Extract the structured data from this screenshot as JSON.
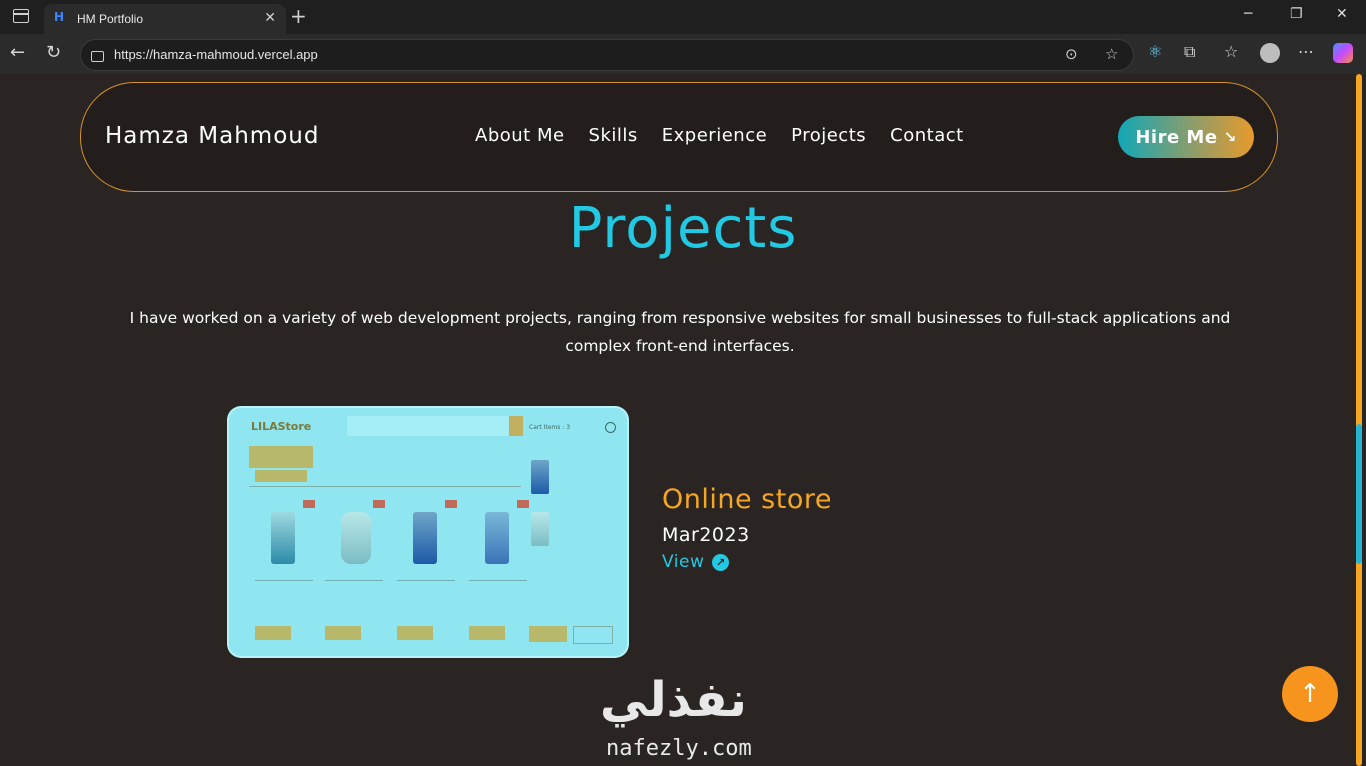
{
  "browser": {
    "tab_title": "HM Portfolio",
    "tab_favicon": "H",
    "url": "https://hamza-mahmoud.vercel.app"
  },
  "navbar": {
    "brand": "Hamza Mahmoud",
    "links": [
      "About Me",
      "Skills",
      "Experience",
      "Projects",
      "Contact"
    ],
    "hire_label": "Hire Me",
    "hire_icon": "arrow-down-right-icon"
  },
  "section": {
    "title": "Projects",
    "intro": "I have worked on a variety of web development projects, ranging from responsive websites for small businesses to full-stack applications and complex front-end interfaces."
  },
  "project": {
    "title": "Online store",
    "date": "Mar2023",
    "view_label": "View",
    "thumbnail": {
      "logo": "LILAStore",
      "cart_label": "Cart Items : 3"
    }
  },
  "watermark": {
    "arabic": "نفذلي",
    "latin": "nafezly.com"
  },
  "colors": {
    "accent_cyan": "#22c9e2",
    "accent_orange": "#f5a623",
    "background": "#2a2523"
  }
}
